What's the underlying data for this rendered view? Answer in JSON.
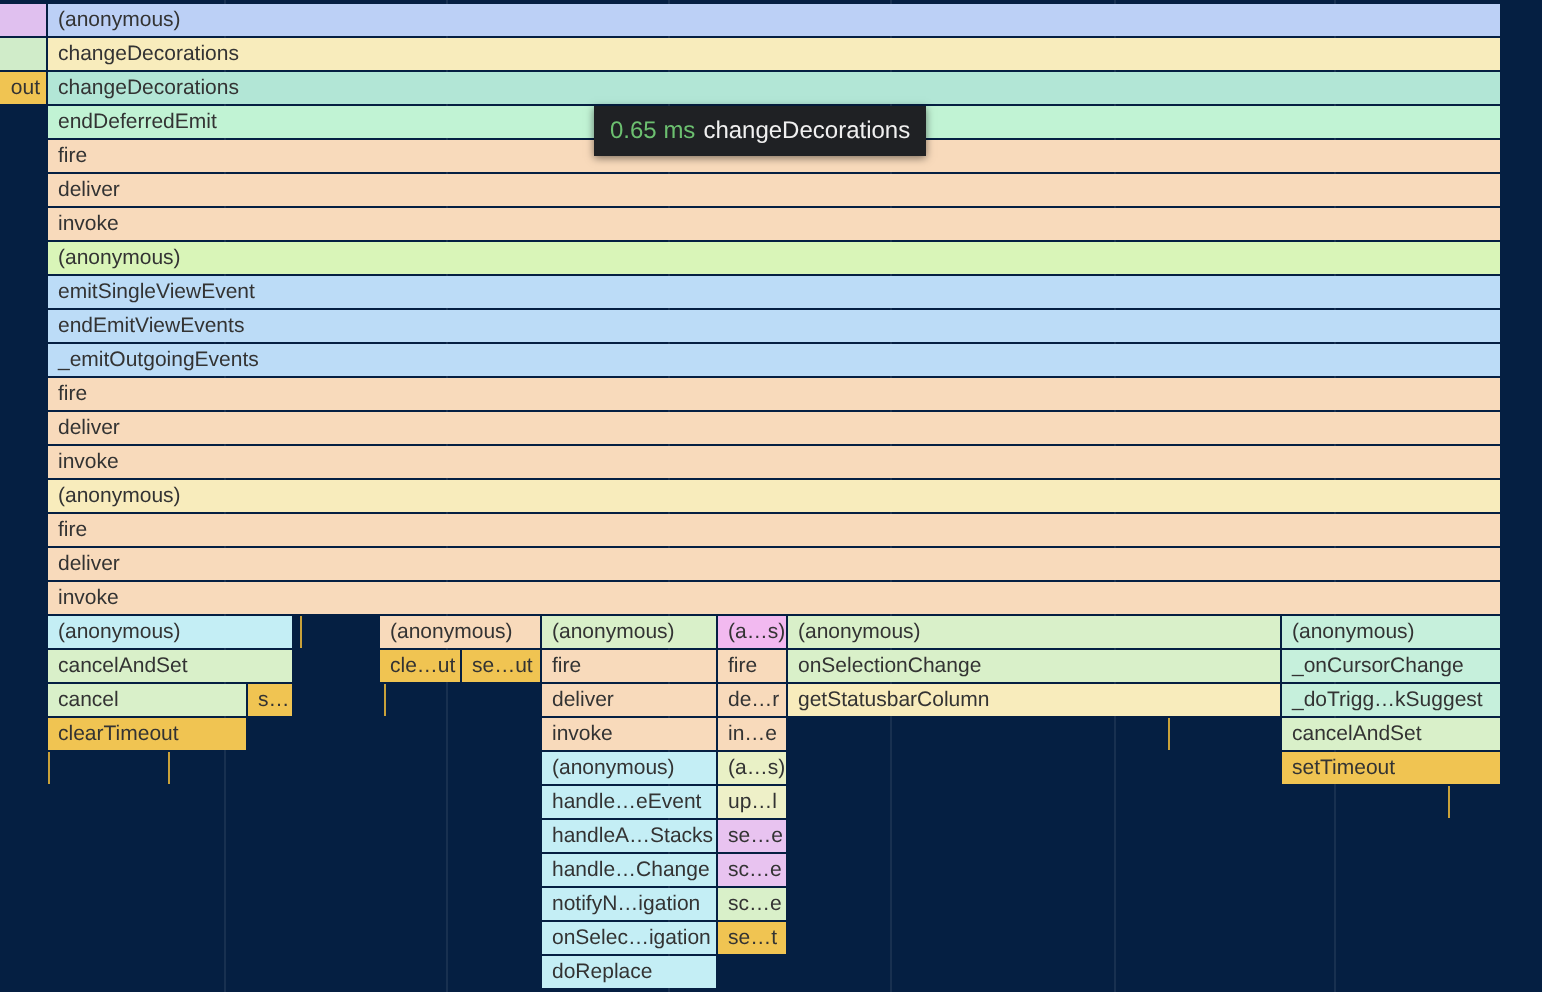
{
  "rows": [
    {
      "frames": [
        {
          "color": "#e0c0ef"
        },
        {
          "label": "(anonymous)",
          "color": "#bcd0f6"
        }
      ]
    },
    {
      "frames": [
        {
          "color": "#d0ecc9"
        },
        {
          "label": "changeDecorations",
          "color": "#f8ecbc"
        }
      ]
    },
    {
      "frames": [
        {
          "label": "out",
          "color": "#f0c452"
        },
        {
          "label": "changeDecorations",
          "color": "#b2e6d6"
        }
      ]
    },
    {
      "frames": [
        {
          "label": "endDeferredEmit",
          "color": "#c1f3d4"
        }
      ]
    },
    {
      "frames": [
        {
          "label": "fire",
          "color": "#f8dabb"
        }
      ]
    },
    {
      "frames": [
        {
          "label": "deliver",
          "color": "#f8dabb"
        }
      ]
    },
    {
      "frames": [
        {
          "label": "invoke",
          "color": "#f8dabb"
        }
      ]
    },
    {
      "frames": [
        {
          "label": "(anonymous)",
          "color": "#d9f5b8"
        }
      ]
    },
    {
      "frames": [
        {
          "label": "emitSingleViewEvent",
          "color": "#bcdcf7"
        }
      ]
    },
    {
      "frames": [
        {
          "label": "endEmitViewEvents",
          "color": "#bcdcf7"
        }
      ]
    },
    {
      "frames": [
        {
          "label": "_emitOutgoingEvents",
          "color": "#bcdcf7"
        }
      ]
    },
    {
      "frames": [
        {
          "label": "fire",
          "color": "#f8dabb"
        }
      ]
    },
    {
      "frames": [
        {
          "label": "deliver",
          "color": "#f8dabb"
        }
      ]
    },
    {
      "frames": [
        {
          "label": "invoke",
          "color": "#f8dabb"
        }
      ]
    },
    {
      "frames": [
        {
          "label": "(anonymous)",
          "color": "#f8ecbc"
        }
      ]
    },
    {
      "frames": [
        {
          "label": "fire",
          "color": "#f8dabb"
        }
      ]
    },
    {
      "frames": [
        {
          "label": "deliver",
          "color": "#f8dabb"
        }
      ]
    },
    {
      "frames": [
        {
          "label": "invoke",
          "color": "#f8dabb"
        }
      ]
    },
    {
      "frames": [
        {
          "label": "(anonymous)",
          "color": "#c4eef5"
        },
        {
          "label": "(anonymous)",
          "color": "#f8dabb"
        },
        {
          "label": "(anonymous)",
          "color": "#d9f0c9"
        },
        {
          "label": "(a…s)",
          "color": "#f2b9f0"
        },
        {
          "label": "(anonymous)",
          "color": "#d9f0c9"
        },
        {
          "label": "(anonymous)",
          "color": "#c6f0dc"
        }
      ]
    },
    {
      "frames": [
        {
          "label": "cancelAndSet",
          "color": "#d9f0c9"
        },
        {
          "label": "cle…ut",
          "color": "#f0c452"
        },
        {
          "label": "se…ut",
          "color": "#f0c452"
        },
        {
          "label": "fire",
          "color": "#f8dabb"
        },
        {
          "label": "fire",
          "color": "#f8dabb"
        },
        {
          "label": "onSelectionChange",
          "color": "#d9f0c9"
        },
        {
          "label": "_onCursorChange",
          "color": "#c6f0dc"
        }
      ]
    },
    {
      "frames": [
        {
          "label": "cancel",
          "color": "#d9f0c9"
        },
        {
          "label": "s…",
          "color": "#f0c452"
        },
        {
          "label": "deliver",
          "color": "#f8dabb"
        },
        {
          "label": "de…r",
          "color": "#f8dabb"
        },
        {
          "label": "getStatusbarColumn",
          "color": "#f8ecbc"
        },
        {
          "label": "_doTrigg…kSuggest",
          "color": "#c6f0dc"
        }
      ]
    },
    {
      "frames": [
        {
          "label": "clearTimeout",
          "color": "#f0c452"
        },
        {
          "label": "invoke",
          "color": "#f8dabb"
        },
        {
          "label": "in…e",
          "color": "#f8dabb"
        },
        {
          "label": "cancelAndSet",
          "color": "#d9f0c9"
        }
      ]
    },
    {
      "frames": [
        {
          "label": "(anonymous)",
          "color": "#c4eef5"
        },
        {
          "label": "(a…s)",
          "color": "#e9f1c6"
        },
        {
          "label": "setTimeout",
          "color": "#f0c452"
        }
      ]
    },
    {
      "frames": [
        {
          "label": "handle…eEvent",
          "color": "#c4eef5"
        },
        {
          "label": "up…l",
          "color": "#eef0c8"
        }
      ]
    },
    {
      "frames": [
        {
          "label": "handleA…Stacks",
          "color": "#c4eef5"
        },
        {
          "label": "se…e",
          "color": "#e8c3f0"
        }
      ]
    },
    {
      "frames": [
        {
          "label": "handle…Change",
          "color": "#c4eef5"
        },
        {
          "label": "sc…e",
          "color": "#e8c3f0"
        }
      ]
    },
    {
      "frames": [
        {
          "label": "notifyN…igation",
          "color": "#c4eef5"
        },
        {
          "label": "sc…e",
          "color": "#d9f0c9"
        }
      ]
    },
    {
      "frames": [
        {
          "label": "onSelec…igation",
          "color": "#c4eef5"
        },
        {
          "label": "se…t",
          "color": "#f0c452"
        }
      ]
    },
    {
      "frames": [
        {
          "label": "doReplace",
          "color": "#c4eef5"
        }
      ]
    }
  ],
  "tooltip": {
    "duration": "0.65 ms",
    "label": "changeDecorations"
  }
}
